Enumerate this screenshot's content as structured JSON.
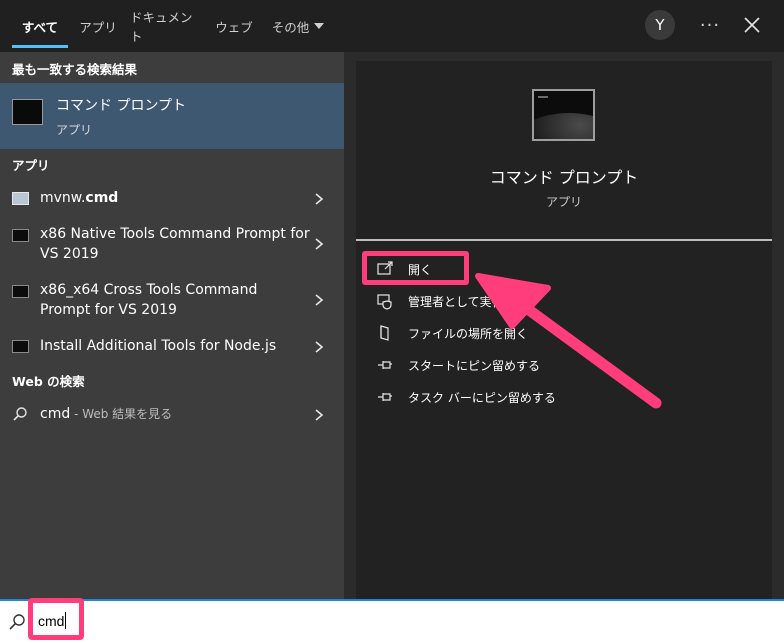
{
  "tabs": [
    {
      "label": "すべて",
      "active": true
    },
    {
      "label": "アプリ"
    },
    {
      "label": "ドキュメント"
    },
    {
      "label": "ウェブ"
    },
    {
      "label": "その他"
    }
  ],
  "header": {
    "avatar_letter": "Y",
    "more_label": "···"
  },
  "best_match": {
    "heading": "最も一致する検索結果",
    "name": "コマンド プロンプト",
    "type": "アプリ"
  },
  "apps": {
    "heading": "アプリ",
    "items": [
      {
        "prefix": "mvnw.",
        "bold": "cmd"
      },
      {
        "label": "x86 Native Tools Command Prompt for VS 2019"
      },
      {
        "label": "x86_x64 Cross Tools Command Prompt for VS 2019"
      },
      {
        "label": "Install Additional Tools for Node.js"
      }
    ]
  },
  "web": {
    "heading": "Web の検索",
    "query": "cmd",
    "suffix": " - Web 結果を見る"
  },
  "detail": {
    "title": "コマンド プロンプト",
    "subtitle": "アプリ",
    "actions": [
      {
        "label": "開く",
        "icon": "open-icon"
      },
      {
        "label": "管理者として実行",
        "icon": "admin-shield-icon"
      },
      {
        "label": "ファイルの場所を開く",
        "icon": "file-location-icon"
      },
      {
        "label": "スタートにピン留めする",
        "icon": "pin-icon"
      },
      {
        "label": "タスク バーにピン留めする",
        "icon": "pin-icon"
      }
    ]
  },
  "search": {
    "value": "cmd"
  },
  "colors": {
    "accent": "#4cc2ff",
    "selection": "#3e5872",
    "highlight": "#ff3c7c",
    "search_border": "#1f88d6"
  }
}
